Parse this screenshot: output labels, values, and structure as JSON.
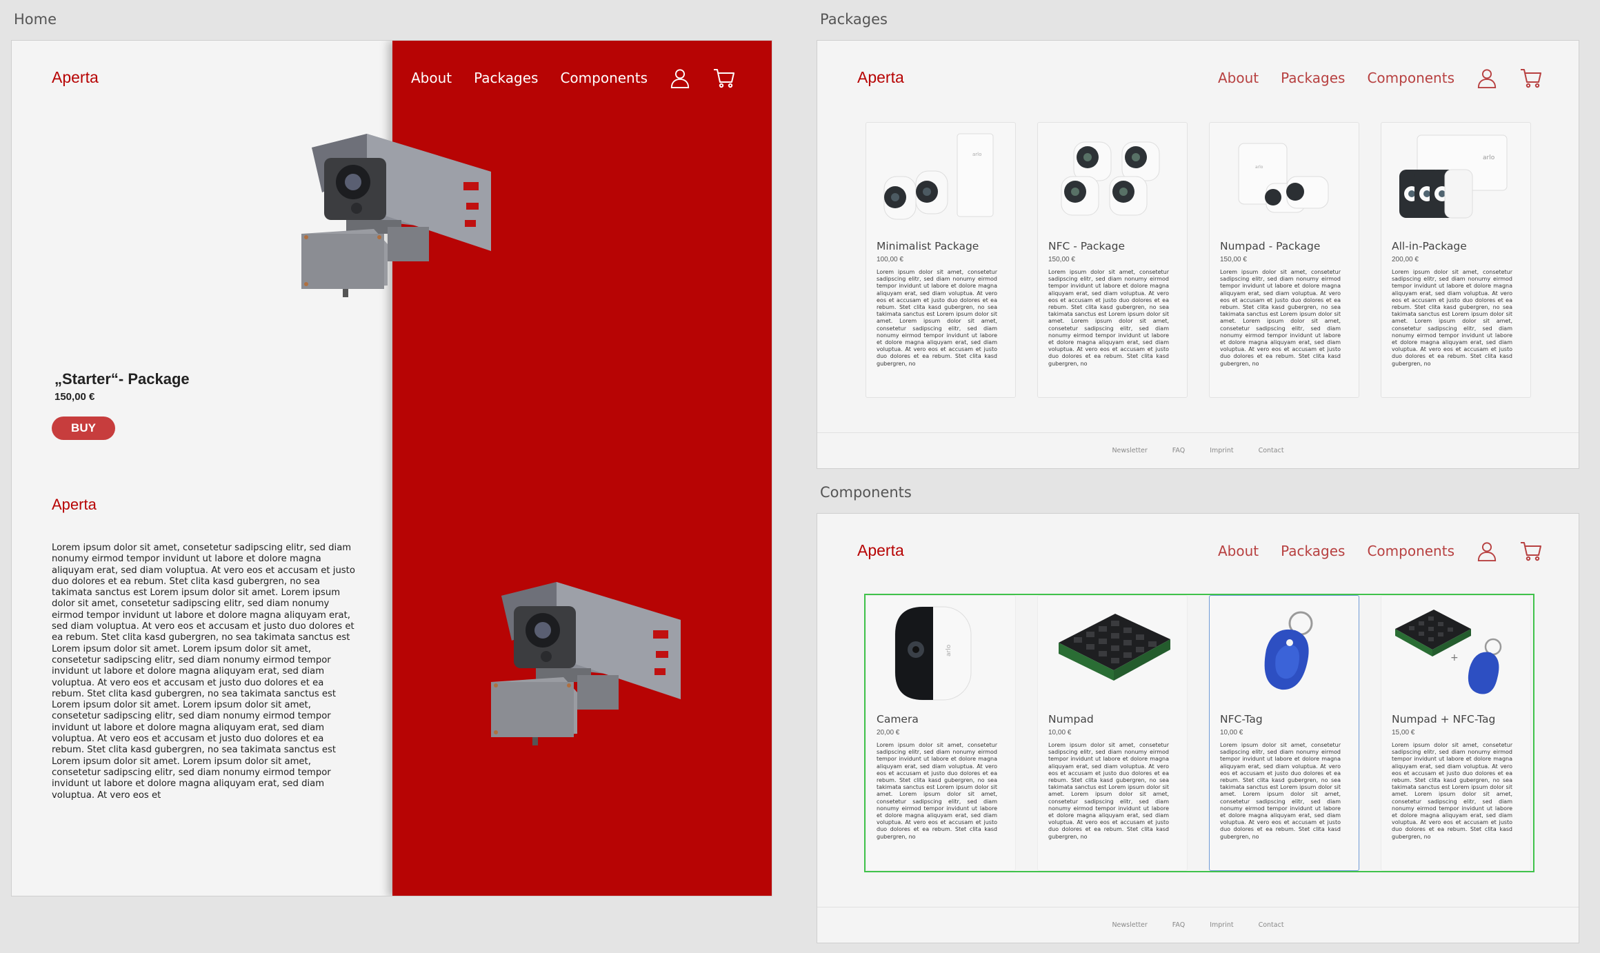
{
  "boards": {
    "home_label": "Home",
    "packages_label": "Packages",
    "components_label": "Components"
  },
  "brand": "Aperta",
  "nav": {
    "about": "About",
    "packages": "Packages",
    "components": "Components",
    "user_icon": "user-icon",
    "cart_icon": "cart-icon"
  },
  "home": {
    "package_title": "„Starter“- Package",
    "package_price": "150,00 €",
    "buy_label": "BUY",
    "about_title": "Aperta",
    "about_text": "Lorem ipsum dolor sit amet, consetetur sadipscing elitr, sed diam nonumy eirmod tempor invidunt ut labore et dolore magna aliquyam erat, sed diam voluptua. At vero eos et accusam et justo duo dolores et ea rebum. Stet clita kasd gubergren, no sea takimata sanctus est Lorem ipsum dolor sit amet. Lorem ipsum dolor sit amet, consetetur sadipscing elitr, sed diam nonumy eirmod tempor invidunt ut labore et dolore magna aliquyam erat, sed diam voluptua. At vero eos et accusam et justo duo dolores et ea rebum. Stet clita kasd gubergren, no sea takimata sanctus est Lorem ipsum dolor sit amet. Lorem ipsum dolor sit amet, consetetur sadipscing elitr, sed diam nonumy eirmod tempor invidunt ut labore et dolore magna aliquyam erat, sed diam voluptua. At vero eos et accusam et justo duo dolores et ea rebum. Stet clita kasd gubergren, no sea takimata sanctus est Lorem ipsum dolor sit amet. Lorem ipsum dolor sit amet, consetetur sadipscing elitr, sed diam nonumy eirmod tempor invidunt ut labore et dolore magna aliquyam erat, sed diam voluptua. At vero eos et accusam et justo duo dolores et ea rebum. Stet clita kasd gubergren, no sea takimata sanctus est Lorem ipsum dolor sit amet. Lorem ipsum dolor sit amet, consetetur sadipscing elitr, sed diam nonumy eirmod tempor invidunt ut labore et dolore magna aliquyam erat, sed diam voluptua. At vero eos et"
  },
  "lorem_short": "Lorem ipsum dolor sit amet, consetetur sadipscing elitr, sed diam nonumy eirmod tempor invidunt ut labore et dolore magna aliquyam erat, sed diam voluptua. At vero eos et accusam et justo duo dolores et ea rebum. Stet clita kasd gubergren, no sea takimata sanctus est Lorem ipsum dolor sit amet. Lorem ipsum dolor sit amet, consetetur sadipscing elitr, sed diam nonumy eirmod tempor invidunt ut labore et dolore magna aliquyam erat, sed diam voluptua. At vero eos et accusam et justo duo dolores et ea rebum. Stet clita kasd gubergren, no",
  "packages": [
    {
      "name": "Minimalist Package",
      "price": "100,00 €"
    },
    {
      "name": "NFC - Package",
      "price": "150,00 €"
    },
    {
      "name": "Numpad - Package",
      "price": "150,00 €"
    },
    {
      "name": "All-in-Package",
      "price": "200,00 €"
    }
  ],
  "components": [
    {
      "name": "Camera",
      "price": "20,00 €"
    },
    {
      "name": "Numpad",
      "price": "10,00 €"
    },
    {
      "name": "NFC-Tag",
      "price": "10,00 €"
    },
    {
      "name": "Numpad + NFC-Tag",
      "price": "15,00 €"
    }
  ],
  "footer": {
    "newsletter": "Newsletter",
    "faq": "FAQ",
    "imprint": "Imprint",
    "contact": "Contact"
  },
  "colors": {
    "brand_red": "#b70404",
    "nav_red": "#b74040",
    "buy_button": "#c73d3d",
    "selection_green": "#3fc24a",
    "selection_blue": "#6f9bd6"
  }
}
